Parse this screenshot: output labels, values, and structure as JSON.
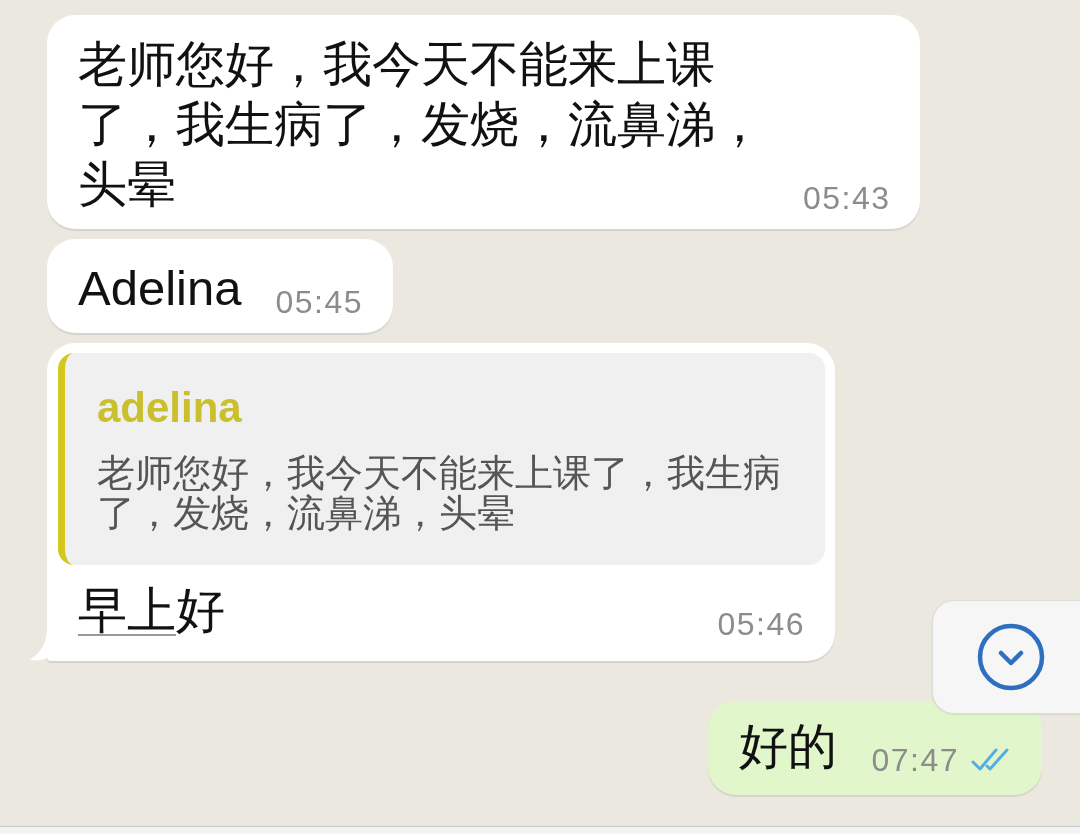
{
  "messages": [
    {
      "outgoing": false,
      "tail": false,
      "text": "老师您好，我今天不能来上课了，我生病了，发烧，流鼻涕，头晕",
      "time": "05:43"
    },
    {
      "outgoing": false,
      "tail": false,
      "text": "Adelina",
      "time": "05:45"
    },
    {
      "outgoing": false,
      "tail": true,
      "reply_to": {
        "author": "adelina",
        "text": "老师您好，我今天不能来上课了，我生病了，发烧，流鼻涕，头晕"
      },
      "text_parts": [
        {
          "kind": "link",
          "text": "早上"
        },
        {
          "kind": "plain",
          "text": "好"
        }
      ],
      "time": "05:46"
    },
    {
      "outgoing": true,
      "tail": false,
      "text": "好的",
      "time": "07:47",
      "read": true
    }
  ]
}
